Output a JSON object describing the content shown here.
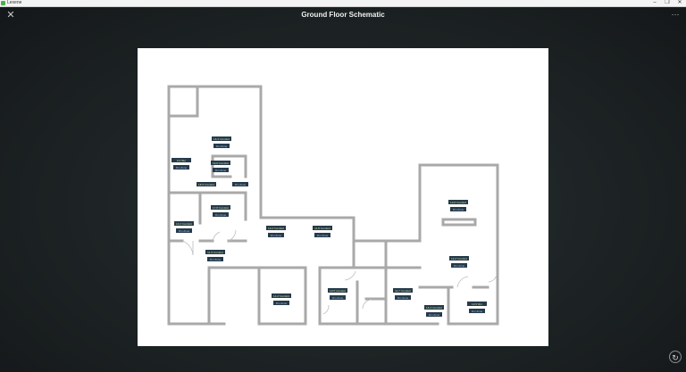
{
  "window": {
    "app_name": "Lexene",
    "minimize_glyph": "–",
    "maximize_glyph": "❐",
    "close_glyph": "✕"
  },
  "header": {
    "title": "Ground Floor Schematic",
    "close_icon": "close-icon",
    "menu_glyph": "···"
  },
  "footer": {
    "refresh_glyph": "↻"
  },
  "colors": {
    "wall": "#a9a9a9",
    "tag_dark": "#263a4a",
    "tag_text": "#cfe3a8",
    "tag_blue_text": "#9ec5e8"
  },
  "room_labels": [
    {
      "top": "16.3' Comfort",
      "bottom": "Rm Zone"
    },
    {
      "top": "9.4' Bur",
      "bottom": "Rm Zone"
    },
    {
      "top": "19.0' Comfort",
      "bottom": "Rm Zone"
    },
    {
      "top": "18.3' Comfort",
      "bottom": ""
    },
    {
      "top": "",
      "bottom": "Rm Zone"
    },
    {
      "top": "17.8' Comfort",
      "bottom": "Rm Zone"
    },
    {
      "top": "10.1' Comfort",
      "bottom": "Rm Zone"
    },
    {
      "top": "16.2' Comfort",
      "bottom": "Rm Zone"
    },
    {
      "top": "11.8' Comfort",
      "bottom": "Rm Zone"
    },
    {
      "top": "11.3' Comfort",
      "bottom": "Rm Zone"
    },
    {
      "top": "14.2' Comfort",
      "bottom": "Rm Zone"
    },
    {
      "top": "19.5' Comfort",
      "bottom": "Rm Zone"
    },
    {
      "top": "11.7' Comfort",
      "bottom": "Rm Zone"
    },
    {
      "top": "13.0' Comfort",
      "bottom": "Rm Zone"
    },
    {
      "top": "12.2' Comfort",
      "bottom": "Rm Zone"
    },
    {
      "top": "16.4' Comfort",
      "bottom": "Rm Zone"
    },
    {
      "top": "11.7' Lab",
      "bottom": "Rm Zone"
    },
    {
      "top": "13.5' Rm",
      "bottom": "Rm Zone"
    }
  ]
}
